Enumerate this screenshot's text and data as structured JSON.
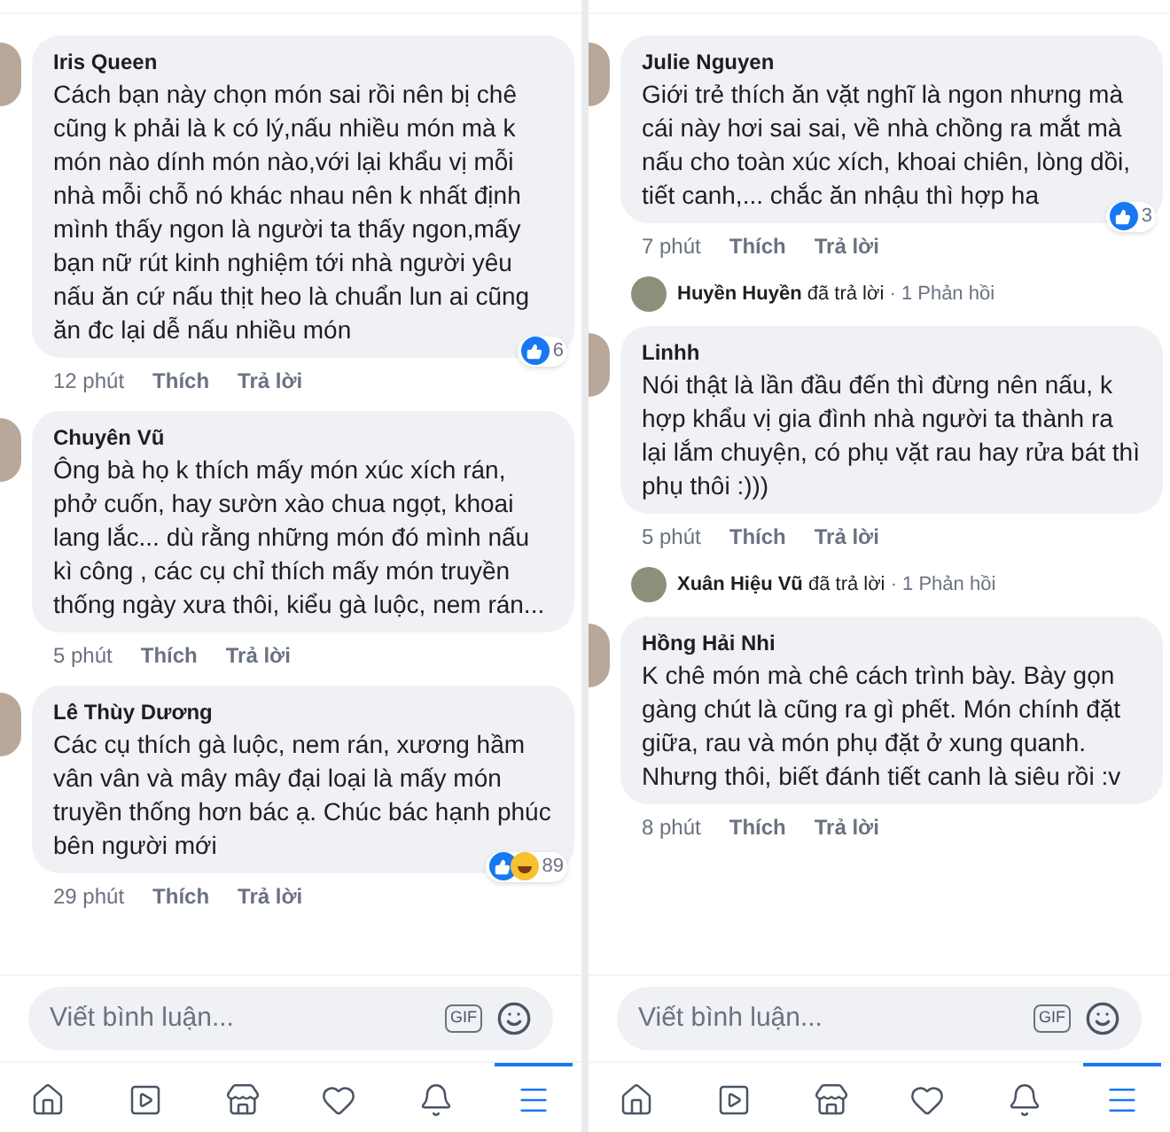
{
  "panels": [
    {
      "items": [
        {
          "kind": "comment",
          "name": "Iris Queen",
          "text": "Cách bạn này chọn món sai rồi nên bị chê cũng k phải là k có lý,nấu nhiều món mà k món nào dính món nào,với lại khẩu vị mỗi nhà mỗi chỗ nó khác nhau nên k nhất định mình thấy ngon là người ta thấy ngon,mấy bạn nữ rút kinh nghiệm tới nhà người yêu nấu ăn cứ nấu thịt heo là chuẩn lun ai cũng ăn đc lại dễ nấu nhiều món",
          "time": "12 phút",
          "like": "Thích",
          "reply": "Trả lời",
          "reactions": [
            {
              "kind": "like"
            }
          ],
          "count": "6"
        },
        {
          "kind": "comment",
          "name": "Chuyên Vũ",
          "text": "Ông bà họ k thích mấy món xúc xích rán, phở cuốn, hay sườn xào chua ngọt, khoai lang lắc... dù rằng những món đó mình nấu kì công , các cụ chỉ thích mấy món truyền thống ngày xưa thôi, kiểu gà luộc, nem rán...",
          "time": "5 phút",
          "like": "Thích",
          "reply": "Trả lời"
        },
        {
          "kind": "comment",
          "name": "Lê Thùy Dương",
          "text": "Các cụ thích gà luộc, nem rán, xương hầm vân vân và mây mây đại loại là mấy món truyền thống hơn bác ạ. Chúc bác hạnh phúc bên người mới",
          "time": "29 phút",
          "like": "Thích",
          "reply": "Trả lời",
          "reactions": [
            {
              "kind": "like"
            },
            {
              "kind": "haha"
            }
          ],
          "count": "89"
        }
      ],
      "composer": {
        "placeholder": "Viết bình luận...",
        "gif": "GIF"
      },
      "nav": [
        {
          "kind": "home",
          "selected": false
        },
        {
          "kind": "video",
          "selected": false
        },
        {
          "kind": "store",
          "selected": false
        },
        {
          "kind": "heart",
          "selected": false
        },
        {
          "kind": "bell",
          "selected": false
        },
        {
          "kind": "menu",
          "selected": true
        }
      ]
    },
    {
      "items": [
        {
          "kind": "comment",
          "name": "Julie Nguyen",
          "text": "Giới trẻ thích ăn vặt nghĩ là ngon nhưng mà cái này hơi sai sai, về nhà chồng ra mắt mà nấu cho toàn xúc xích, khoai chiên, lòng dồi, tiết canh,... chắc ăn nhậu thì hợp ha",
          "time": "7 phút",
          "like": "Thích",
          "reply": "Trả lời",
          "reactions": [
            {
              "kind": "like"
            }
          ],
          "count": "3"
        },
        {
          "kind": "reply_summary",
          "name": "Huyền Huyền",
          "action": "đã trả lời",
          "count": "· 1 Phản hồi"
        },
        {
          "kind": "comment",
          "name": "Linhh",
          "text": "Nói thật là lần đầu đến thì đừng nên nấu, k hợp khẩu vị gia đình nhà người ta thành ra lại lắm chuyện, có phụ vặt rau hay rửa bát thì phụ thôi :)))",
          "time": "5 phút",
          "like": "Thích",
          "reply": "Trả lời"
        },
        {
          "kind": "reply_summary",
          "name": "Xuân Hiệu Vũ",
          "action": "đã trả lời",
          "count": "· 1 Phản hồi"
        },
        {
          "kind": "comment",
          "name": "Hồng Hải Nhi",
          "text": "K chê món mà chê cách trình bày. Bày gọn gàng chút là cũng ra gì phết. Món chính đặt giữa, rau và món phụ đặt ở xung quanh.\nNhưng thôi, biết đánh tiết canh là siêu rồi :v",
          "time": "8 phút",
          "like": "Thích",
          "reply": "Trả lời"
        }
      ],
      "composer": {
        "placeholder": "Viết bình luận...",
        "gif": "GIF"
      },
      "nav": [
        {
          "kind": "home",
          "selected": false
        },
        {
          "kind": "video",
          "selected": false
        },
        {
          "kind": "store",
          "selected": false
        },
        {
          "kind": "heart",
          "selected": false
        },
        {
          "kind": "bell",
          "selected": false
        },
        {
          "kind": "menu",
          "selected": true
        }
      ]
    }
  ]
}
